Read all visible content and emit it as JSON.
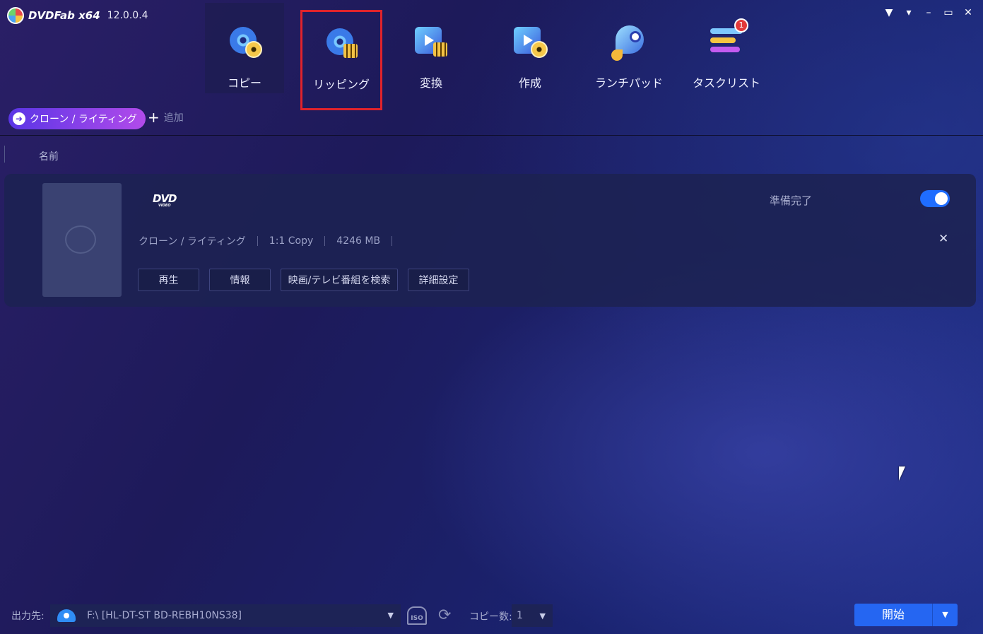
{
  "app": {
    "brand": "DVDFab x64",
    "version": "12.0.0.4"
  },
  "window_controls": [
    "shirt-icon",
    "menu-dropdown-icon",
    "minimize-icon",
    "maximize-icon",
    "close-icon"
  ],
  "nav": {
    "copy": "コピー",
    "ripping": "リッピング",
    "convert": "変換",
    "create": "作成",
    "launchpad": "ランチパッド",
    "tasklist": "タスクリスト",
    "tasklist_badge": "1"
  },
  "toolbar": {
    "mode": "クローン / ライティング",
    "add": "追加"
  },
  "list_header": {
    "name": "名前"
  },
  "task": {
    "disc_logo": "DVD",
    "disc_logo_sub": "VIDEO",
    "status": "準備完了",
    "enabled": true,
    "mode": "クローン / ライティング",
    "copy_type": "1:1 Copy",
    "size": "4246 MB",
    "buttons": {
      "play": "再生",
      "info": "情報",
      "search": "映画/テレビ番組を検索",
      "settings": "詳細設定"
    }
  },
  "bottom": {
    "output_label": "出力先:",
    "output_value": "F:\\ [HL-DT-ST BD-REBH10NS38]",
    "iso_label": "ISO",
    "copies_label": "コピー数:",
    "copies_value": "1",
    "start": "開始"
  },
  "colors": {
    "accent": "#2566f2",
    "highlight_box": "#e0232b",
    "pill_start": "#5a35e6",
    "pill_end": "#b24bea"
  }
}
